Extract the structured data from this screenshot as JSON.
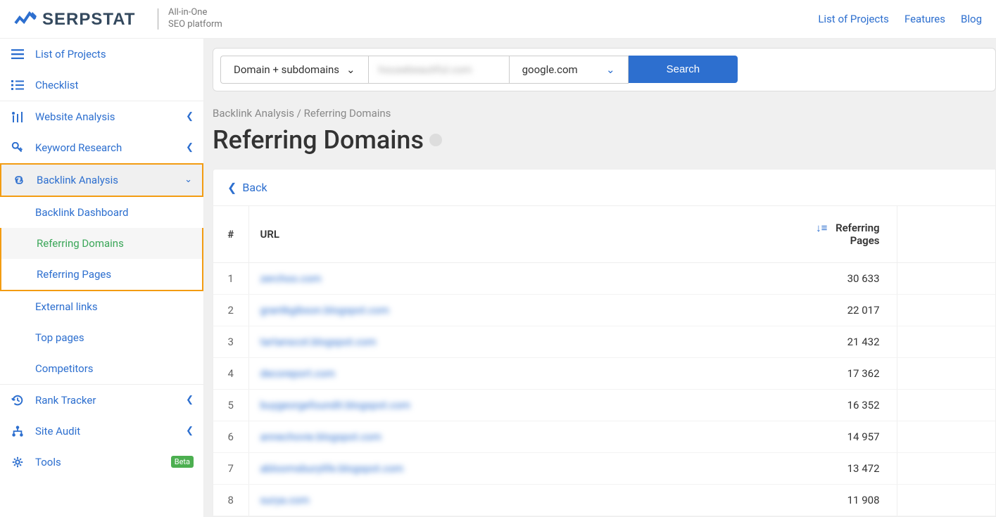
{
  "header": {
    "logo_text": "SERPSTAT",
    "tagline_line1": "All-in-One",
    "tagline_line2": "SEO platform"
  },
  "top_nav": [
    {
      "label": "List of Projects"
    },
    {
      "label": "Features"
    },
    {
      "label": "Blog"
    }
  ],
  "sidebar": {
    "list_of_projects": "List of Projects",
    "checklist": "Checklist",
    "website_analysis": "Website Analysis",
    "keyword_research": "Keyword Research",
    "backlink_analysis": "Backlink Analysis",
    "backlink_dashboard": "Backlink Dashboard",
    "referring_domains": "Referring Domains",
    "referring_pages": "Referring Pages",
    "external_links": "External links",
    "top_pages": "Top pages",
    "competitors": "Competitors",
    "rank_tracker": "Rank Tracker",
    "site_audit": "Site Audit",
    "tools": "Tools",
    "beta": "Beta"
  },
  "search": {
    "scope": "Domain + subdomains",
    "domain": "housebeautiful.com",
    "engine": "google.com",
    "button": "Search"
  },
  "breadcrumb": "Backlink Analysis / Referring Domains",
  "page_title": "Referring Domains",
  "back": "Back",
  "table": {
    "columns": {
      "num": "#",
      "url": "URL",
      "pages": "Referring Pages"
    },
    "rows": [
      {
        "num": "1",
        "url": "zerchoo.com",
        "pages": "30 633"
      },
      {
        "num": "2",
        "url": "grantkgibson.blogspot.com",
        "pages": "22 017"
      },
      {
        "num": "3",
        "url": "tartanscot.blogspot.com",
        "pages": "21 432"
      },
      {
        "num": "4",
        "url": "decoreport.com",
        "pages": "17 362"
      },
      {
        "num": "5",
        "url": "buygeorgefoundit.blogspot.com",
        "pages": "16 352"
      },
      {
        "num": "6",
        "url": "annechovie.blogspot.com",
        "pages": "14 957"
      },
      {
        "num": "7",
        "url": "abloomsburylife.blogspot.com",
        "pages": "13 472"
      },
      {
        "num": "8",
        "url": "surya.com",
        "pages": "11 908"
      }
    ]
  }
}
